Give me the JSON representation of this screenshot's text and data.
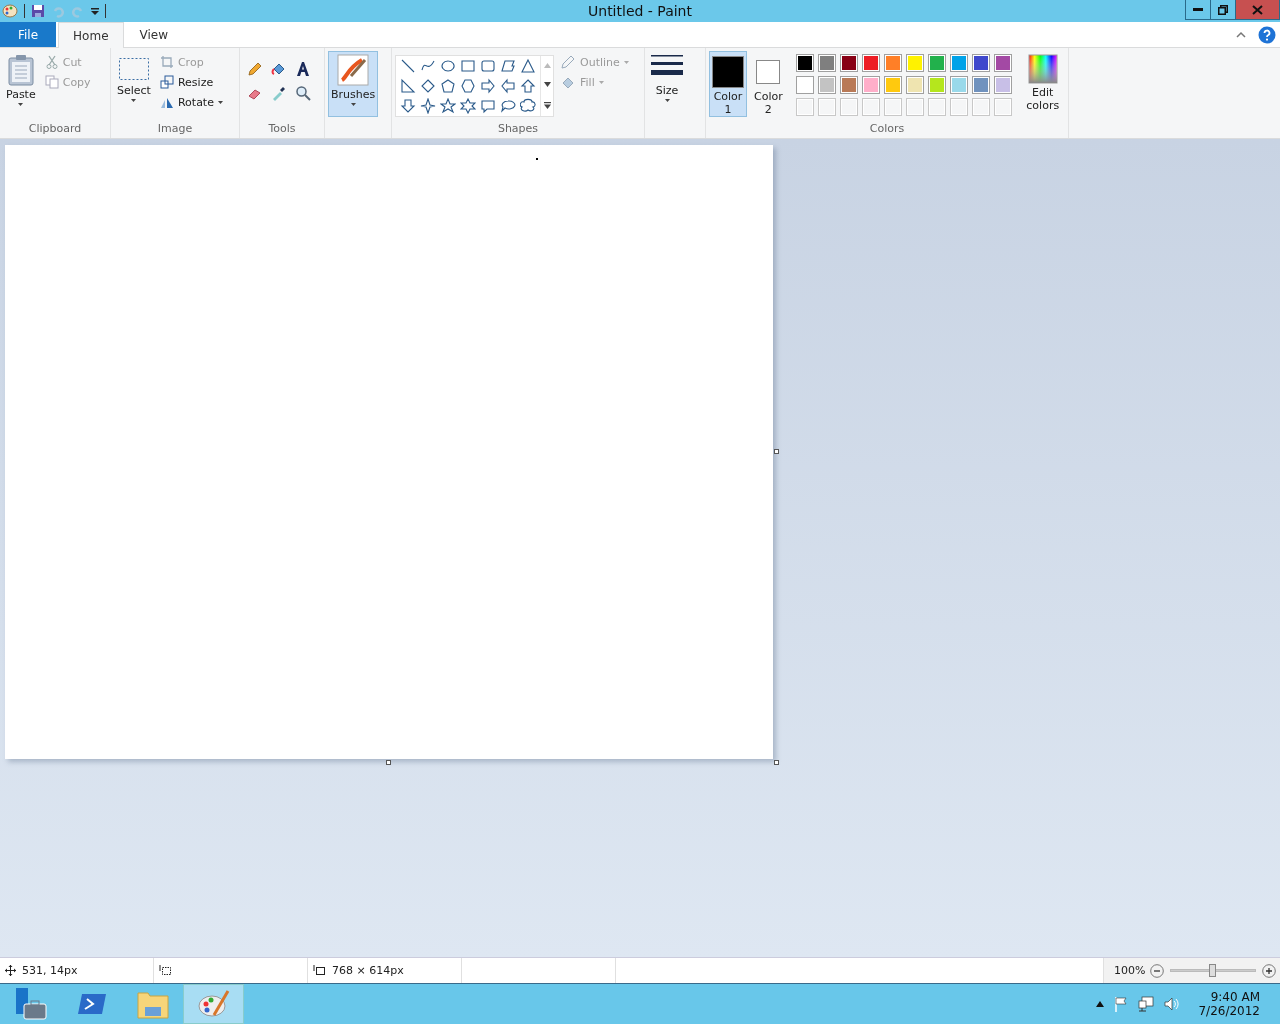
{
  "window": {
    "title": "Untitled - Paint"
  },
  "tabs": [
    {
      "label": "File",
      "kind": "file",
      "selected": false
    },
    {
      "label": "Home",
      "kind": "tab",
      "selected": true
    },
    {
      "label": "View",
      "kind": "tab",
      "selected": false
    }
  ],
  "clipboard": {
    "paste": "Paste",
    "cut": {
      "label": "Cut",
      "disabled": true
    },
    "copy": {
      "label": "Copy",
      "disabled": true
    },
    "label": "Clipboard"
  },
  "image": {
    "select": "Select",
    "crop": {
      "label": "Crop",
      "disabled": true
    },
    "resize": {
      "label": "Resize",
      "disabled": false
    },
    "rotate": {
      "label": "Rotate",
      "disabled": false
    },
    "label": "Image"
  },
  "tools": {
    "label": "Tools"
  },
  "brushes": {
    "label": "Brushes",
    "selected": true
  },
  "shapes": {
    "outline": {
      "label": "Outline",
      "disabled": true
    },
    "fill": {
      "label": "Fill",
      "disabled": true
    },
    "label": "Shapes"
  },
  "size": {
    "label": "Size"
  },
  "colors": {
    "color1": {
      "label": "Color",
      "number": "1",
      "selected": true,
      "color": "#000000"
    },
    "color2": {
      "label": "Color",
      "number": "2",
      "selected": false,
      "color": "#ffffff"
    },
    "palette": [
      {
        "kind": "swatch",
        "color": "#000000"
      },
      {
        "kind": "swatch",
        "color": "#7f7f7f"
      },
      {
        "kind": "swatch",
        "color": "#880015"
      },
      {
        "kind": "swatch",
        "color": "#ed1c24"
      },
      {
        "kind": "swatch",
        "color": "#ff7f27"
      },
      {
        "kind": "swatch",
        "color": "#fff200"
      },
      {
        "kind": "swatch",
        "color": "#22b14c"
      },
      {
        "kind": "swatch",
        "color": "#00a2e8"
      },
      {
        "kind": "swatch",
        "color": "#3f48cc"
      },
      {
        "kind": "swatch",
        "color": "#a349a4"
      },
      {
        "kind": "swatch",
        "color": "#ffffff"
      },
      {
        "kind": "swatch",
        "color": "#c3c3c3"
      },
      {
        "kind": "swatch",
        "color": "#b97a57"
      },
      {
        "kind": "swatch",
        "color": "#ffaec9"
      },
      {
        "kind": "swatch",
        "color": "#ffc90e"
      },
      {
        "kind": "swatch",
        "color": "#efe4b0"
      },
      {
        "kind": "swatch",
        "color": "#b5e61d"
      },
      {
        "kind": "swatch",
        "color": "#99d9ea"
      },
      {
        "kind": "swatch",
        "color": "#7092be"
      },
      {
        "kind": "swatch",
        "color": "#c8bfe7"
      },
      {
        "kind": "empty"
      },
      {
        "kind": "empty"
      },
      {
        "kind": "empty"
      },
      {
        "kind": "empty"
      },
      {
        "kind": "empty"
      },
      {
        "kind": "empty"
      },
      {
        "kind": "empty"
      },
      {
        "kind": "empty"
      },
      {
        "kind": "empty"
      },
      {
        "kind": "empty"
      }
    ],
    "edit": "Edit colors",
    "label": "Colors"
  },
  "status_bar": {
    "position": "531, 14px",
    "canvas_size": "768 × 614px",
    "zoom": "100%",
    "zoom_level": {
      "level": 0.5
    }
  },
  "taskbar": {
    "apps": [
      {
        "kind": "server",
        "selected": false
      },
      {
        "kind": "shell",
        "selected": false
      },
      {
        "kind": "folder",
        "selected": false
      },
      {
        "kind": "paint",
        "selected": true
      }
    ],
    "time": "9:40 AM",
    "date": "7/26/2012"
  }
}
